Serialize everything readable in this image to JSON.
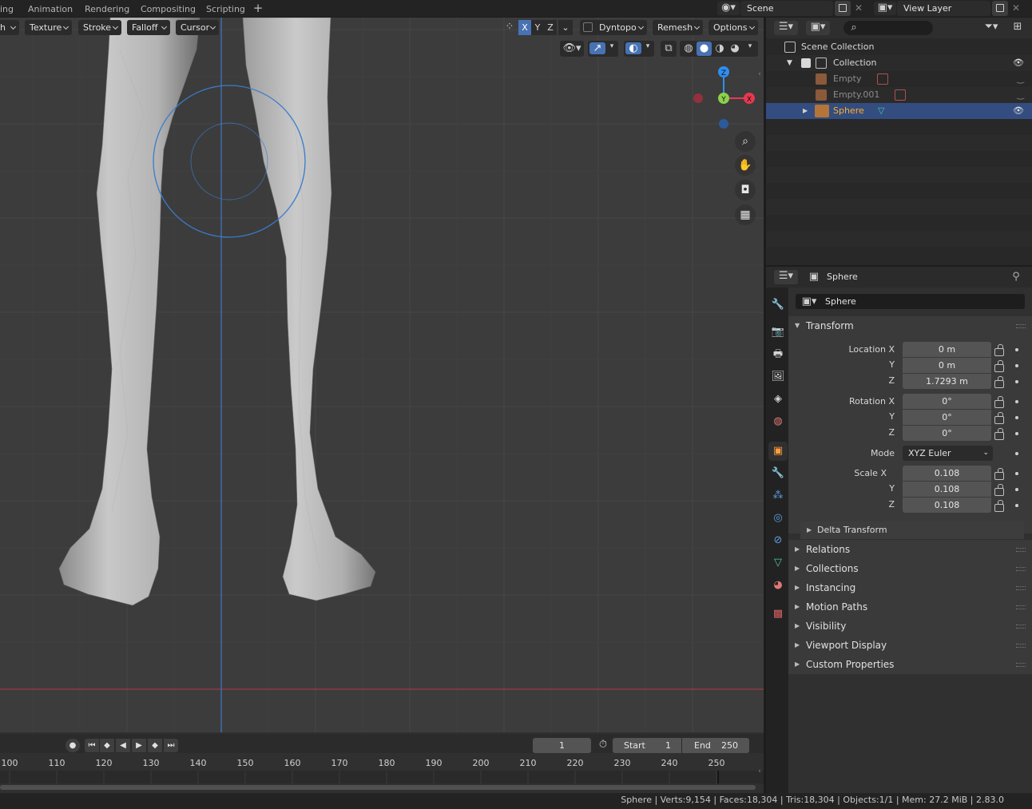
{
  "topbar": {
    "tabs": [
      "ing",
      "Animation",
      "Rendering",
      "Compositing",
      "Scripting"
    ],
    "add_tab": "+",
    "scene": "Scene",
    "view_layer": "View Layer"
  },
  "sculpt_header": {
    "dropdowns": [
      "h",
      "Texture",
      "Stroke",
      "Falloff",
      "Cursor"
    ],
    "axes": [
      "X",
      "Y",
      "Z"
    ],
    "active_axis": "X",
    "dyntopo": "Dyntopo",
    "remesh": "Remesh",
    "options": "Options"
  },
  "gizmo": {
    "z": "Z",
    "y": "Y",
    "x": "X"
  },
  "viewport": {
    "nav_icons": [
      "zoom-icon",
      "hand-pan-icon",
      "camera-icon",
      "grid-icon"
    ]
  },
  "timeline": {
    "current_frame": "1",
    "start_label": "Start",
    "start": "1",
    "end_label": "End",
    "end": "250",
    "ruler": [
      "100",
      "110",
      "120",
      "130",
      "140",
      "150",
      "160",
      "170",
      "180",
      "190",
      "200",
      "210",
      "220",
      "230",
      "240",
      "250"
    ]
  },
  "statusbar": "Sphere | Verts:9,154 | Faces:18,304 | Tris:18,304 | Objects:1/1 | Mem: 27.2 MiB | 2.83.0",
  "outliner": {
    "rows": [
      {
        "label": "Scene Collection"
      },
      {
        "label": "Collection"
      },
      {
        "label": "Empty"
      },
      {
        "label": "Empty.001"
      },
      {
        "label": "Sphere"
      }
    ]
  },
  "properties": {
    "header_object": "Sphere",
    "object_name": "Sphere",
    "transform_label": "Transform",
    "location_label": "Location X",
    "rotation_label": "Rotation X",
    "scale_label": "Scale X",
    "y_label": "Y",
    "z_label": "Z",
    "mode_label": "Mode",
    "mode_value": "XYZ Euler",
    "location": [
      "0 m",
      "0 m",
      "1.7293 m"
    ],
    "rotation": [
      "0°",
      "0°",
      "0°"
    ],
    "scale": [
      "0.108",
      "0.108",
      "0.108"
    ],
    "delta_transform": "Delta Transform",
    "panels": [
      "Relations",
      "Collections",
      "Instancing",
      "Motion Paths",
      "Visibility",
      "Viewport Display",
      "Custom Properties"
    ]
  },
  "colors": {
    "accent": "#4772b3",
    "selected_row": "#334d80",
    "x_axis": "#e8384f",
    "y_axis": "#8bd14b",
    "z_axis": "#2f8ff2",
    "viewport_bg": "#3c3c3c"
  }
}
